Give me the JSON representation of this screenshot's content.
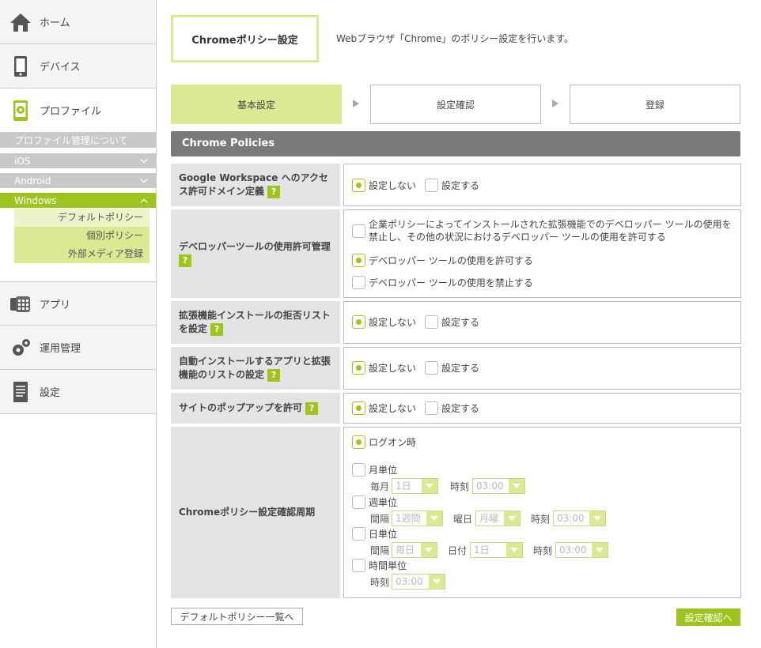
{
  "sidebar": {
    "home": "ホーム",
    "device": "デバイス",
    "profile": "プロファイル",
    "sub": [
      "プロファイル管理について",
      "iOS",
      "Android",
      "Windows"
    ],
    "leaves": [
      "デフォルトポリシー",
      "個別ポリシー",
      "外部メディア登録"
    ],
    "app": "アプリ",
    "ops": "運用管理",
    "settings": "設定"
  },
  "header": {
    "title": "Chromeポリシー設定",
    "desc": "Webブラウザ「Chrome」のポリシー設定を行います。"
  },
  "steps": [
    "基本設定",
    "設定確認",
    "登録"
  ],
  "section_title": "Chrome Policies",
  "rows": {
    "r1": {
      "label": "Google Workspace へのアクセス許可ドメイン定義",
      "opt_off": "設定しない",
      "opt_on": "設定する"
    },
    "r2": {
      "label": "デベロッパーツールの使用許可管理",
      "opt1": "企業ポリシーによってインストールされた拡張機能でのデベロッパー ツールの使用を禁止し、その他の状況におけるデベロッパー ツールの使用を許可する",
      "opt2": "デベロッパー ツールの使用を許可する",
      "opt3": "デベロッパー ツールの使用を禁止する"
    },
    "r3": {
      "label": "拡張機能インストールの拒否リストを設定",
      "opt_off": "設定しない",
      "opt_on": "設定する"
    },
    "r4": {
      "label": "自動インストールするアプリと拡張機能のリストの設定",
      "opt_off": "設定しない",
      "opt_on": "設定する"
    },
    "r5": {
      "label": "サイトのポップアップを許可",
      "opt_off": "設定しない",
      "opt_on": "設定する"
    },
    "r6": {
      "label": "Chromeポリシー設定確認周期",
      "logon": "ログオン時",
      "monthly": "月単位",
      "weekly": "週単位",
      "daily": "日単位",
      "hourly": "時間単位",
      "every_month": "毎月",
      "time": "時刻",
      "interval": "間隔",
      "weekday": "曜日",
      "date": "日付",
      "sel_1day": "1日",
      "sel_time": "03:00",
      "sel_1week": "1週間",
      "sel_monday": "月曜",
      "sel_everyday": "毎日"
    }
  },
  "help_mark": "?",
  "footer": {
    "back": "デフォルトポリシー一覧へ",
    "next": "設定確認へ"
  }
}
